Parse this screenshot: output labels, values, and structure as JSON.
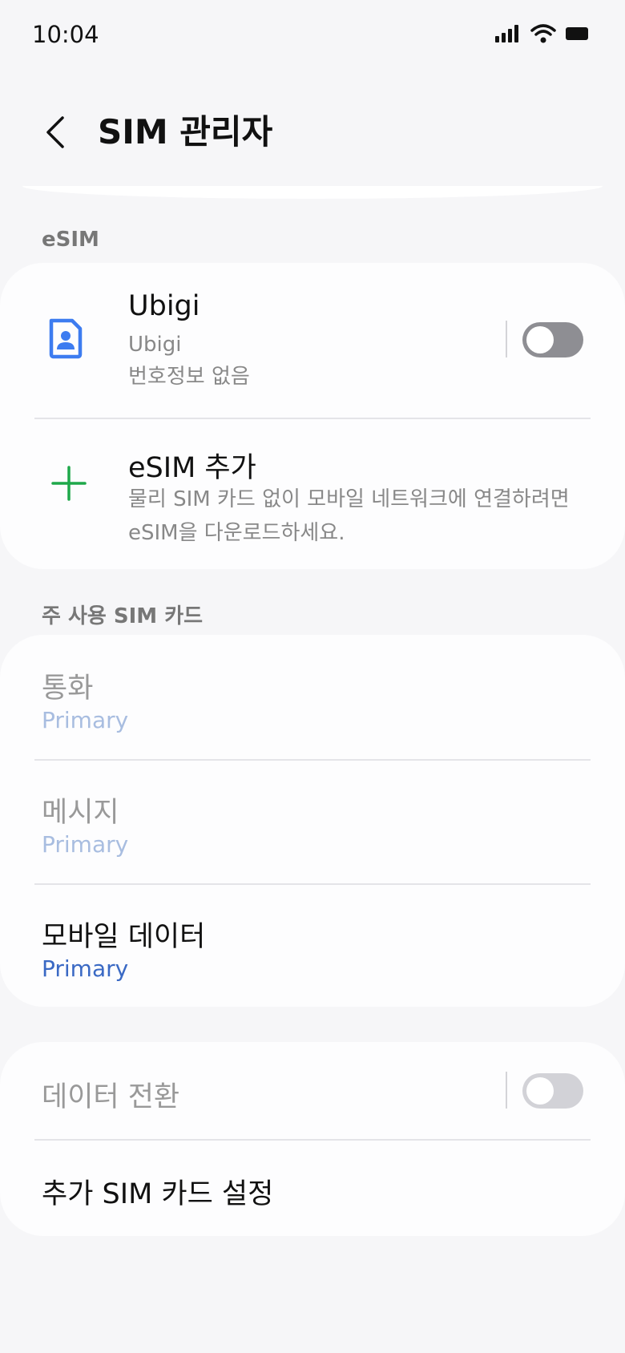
{
  "status": {
    "time": "10:04",
    "icons": [
      "signal-icon",
      "wifi-icon",
      "battery-icon"
    ]
  },
  "header": {
    "back_icon": "chevron-left-icon",
    "title": "SIM 관리자"
  },
  "esim_section": {
    "label": "eSIM",
    "sim": {
      "icon": "sim-card-icon",
      "name": "Ubigi",
      "carrier": "Ubigi",
      "number": "번호정보 없음",
      "toggle_on": false
    },
    "add": {
      "icon": "plus-icon",
      "title": "eSIM 추가",
      "desc_line1": "물리 SIM 카드 없이 모바일 네트워크에 연결하려면",
      "desc_line2": "eSIM을 다운로드하세요."
    }
  },
  "primary_section": {
    "label": "주 사용 SIM 카드",
    "items": [
      {
        "title": "통화",
        "value": "Primary",
        "enabled": false
      },
      {
        "title": "메시지",
        "value": "Primary",
        "enabled": false
      },
      {
        "title": "모바일 데이터",
        "value": "Primary",
        "enabled": true
      }
    ]
  },
  "more_section": {
    "data_switch": {
      "title": "데이터 전환",
      "enabled": false,
      "toggle_on": false
    },
    "extra_settings": {
      "title": "추가 SIM 카드 설정"
    }
  },
  "colors": {
    "accent_blue": "#3a69c4",
    "sim_icon_blue": "#3d7cf0",
    "plus_green": "#1ea84a",
    "background": "#f6f6f8",
    "card": "#fdfdfe"
  }
}
